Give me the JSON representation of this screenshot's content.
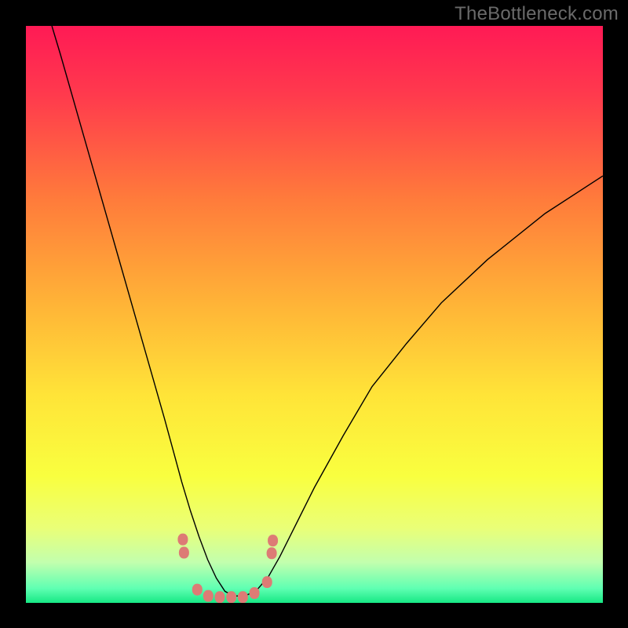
{
  "watermark": "TheBottleneck.com",
  "chart_data": {
    "type": "line",
    "title": "",
    "xlabel": "",
    "ylabel": "",
    "xlim": [
      0,
      100
    ],
    "ylim": [
      0,
      100
    ],
    "axes_visible": false,
    "grid": false,
    "background_gradient": {
      "type": "vertical",
      "stops": [
        {
          "pos": 0.0,
          "color": "#ff1a55"
        },
        {
          "pos": 0.12,
          "color": "#ff3a4d"
        },
        {
          "pos": 0.3,
          "color": "#ff7b3b"
        },
        {
          "pos": 0.48,
          "color": "#ffb337"
        },
        {
          "pos": 0.64,
          "color": "#ffe438"
        },
        {
          "pos": 0.78,
          "color": "#f9ff3f"
        },
        {
          "pos": 0.87,
          "color": "#eaff77"
        },
        {
          "pos": 0.93,
          "color": "#c2ffae"
        },
        {
          "pos": 0.975,
          "color": "#5fffb2"
        },
        {
          "pos": 1.0,
          "color": "#17e884"
        }
      ]
    },
    "series": [
      {
        "name": "bottleneck-curve",
        "color": "#000000",
        "width": 1.4,
        "x": [
          4.5,
          6,
          8,
          10,
          12,
          14,
          16,
          18,
          20,
          22,
          24,
          25.5,
          27,
          28.5,
          30,
          31.5,
          33,
          34.5,
          36,
          38,
          40,
          42,
          44,
          46,
          50,
          55,
          60,
          66,
          72,
          80,
          90,
          100
        ],
        "y": [
          100,
          95,
          88,
          81,
          74,
          67,
          60,
          53,
          46,
          39,
          32,
          26.5,
          21,
          16,
          11.5,
          7.5,
          4.3,
          2,
          1.2,
          1.2,
          2.2,
          4.5,
          8,
          12,
          20,
          29,
          37.5,
          45,
          52,
          59.5,
          67.5,
          74
        ]
      }
    ],
    "markers": {
      "color": "#dd7b75",
      "shape": "round-rect",
      "points": [
        {
          "x": 27.2,
          "y": 11.0
        },
        {
          "x": 27.4,
          "y": 8.7
        },
        {
          "x": 29.7,
          "y": 2.3
        },
        {
          "x": 31.6,
          "y": 1.2
        },
        {
          "x": 33.6,
          "y": 1.0
        },
        {
          "x": 35.6,
          "y": 1.0
        },
        {
          "x": 37.6,
          "y": 1.0
        },
        {
          "x": 39.6,
          "y": 1.7
        },
        {
          "x": 41.8,
          "y": 3.6
        },
        {
          "x": 42.6,
          "y": 8.6
        },
        {
          "x": 42.8,
          "y": 10.8
        }
      ]
    }
  }
}
